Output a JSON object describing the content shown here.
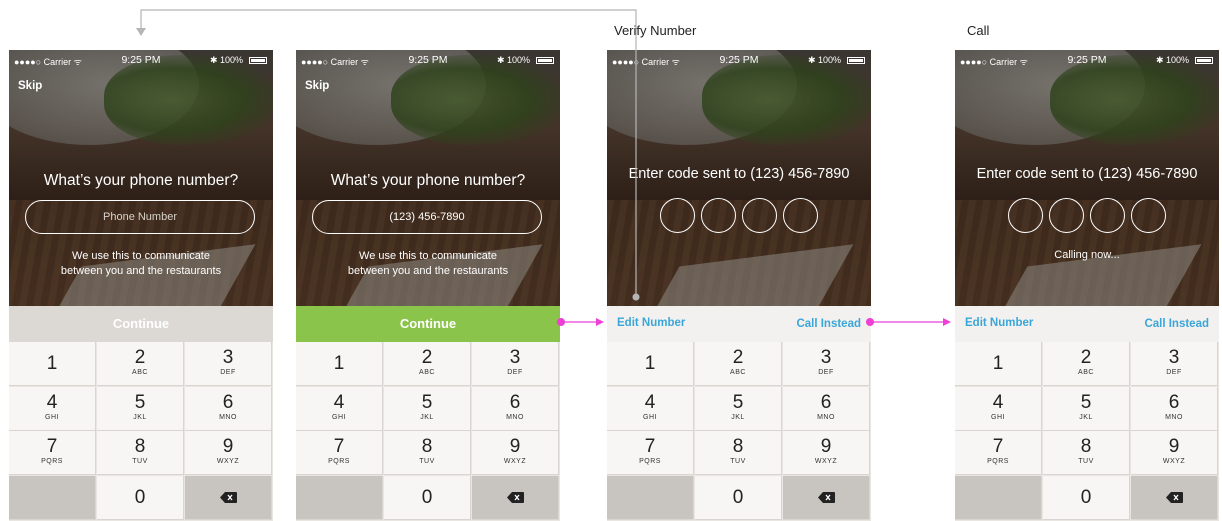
{
  "frame_labels": {
    "verify": "Verify Number",
    "call": "Call"
  },
  "status_bar": {
    "carrier": "●●●●○ Carrier ᯤ",
    "time": "9:25 PM",
    "battery": "✱ 100%"
  },
  "screens": [
    {
      "skip": "Skip",
      "headline": "What’s your phone number?",
      "phone_input": {
        "placeholder": "Phone Number"
      },
      "note_line1": "We use this to communicate",
      "note_line2": "between you and the restaurants",
      "continue_label": "Continue",
      "continue_enabled": false
    },
    {
      "skip": "Skip",
      "headline": "What’s your phone number?",
      "phone_input": {
        "value": "(123) 456-7890"
      },
      "note_line1": "We use this to communicate",
      "note_line2": "between you and the restaurants",
      "continue_label": "Continue",
      "continue_enabled": true,
      "continue_color": "#8bc44a"
    },
    {
      "headline": "Enter code sent to (123) 456-7890",
      "code_digits": 4,
      "edit_label": "Edit Number",
      "call_label": "Call Instead"
    },
    {
      "headline": "Enter code sent to (123) 456-7890",
      "code_digits": 4,
      "calling_text": "Calling now...",
      "edit_label": "Edit Number",
      "call_label": "Call Instead"
    }
  ],
  "keypad": [
    {
      "num": "1",
      "letters": ""
    },
    {
      "num": "2",
      "letters": "ABC"
    },
    {
      "num": "3",
      "letters": "DEF"
    },
    {
      "num": "4",
      "letters": "GHI"
    },
    {
      "num": "5",
      "letters": "JKL"
    },
    {
      "num": "6",
      "letters": "MNO"
    },
    {
      "num": "7",
      "letters": "PQRS"
    },
    {
      "num": "8",
      "letters": "TUV"
    },
    {
      "num": "9",
      "letters": "WXYZ"
    },
    {
      "num": "0",
      "letters": ""
    }
  ],
  "colors": {
    "link": "#3aa6d8",
    "connector_pink": "#ee3fd6",
    "connector_gray": "#b5b5b5",
    "continue_green": "#8bc44a"
  }
}
